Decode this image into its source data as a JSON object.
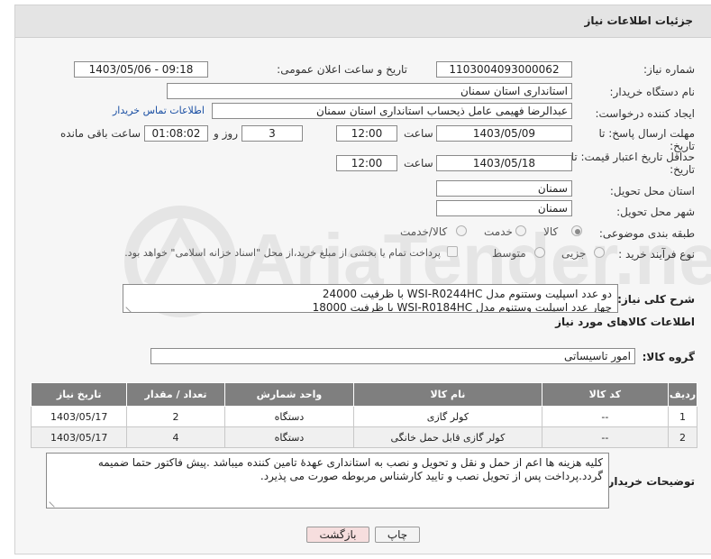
{
  "header": {
    "title": "جزئیات اطلاعات نیاز"
  },
  "fields": {
    "need_number": {
      "label": "شماره نیاز:",
      "value": "1103004093000062"
    },
    "announce_datetime": {
      "label": "تاریخ و ساعت اعلان عمومی:",
      "value": "1403/05/06 - 09:18"
    },
    "buyer_org": {
      "label": "نام دستگاه خریدار:",
      "value": "استانداری استان سمنان"
    },
    "requester": {
      "label": "ایجاد کننده درخواست:",
      "value": "عبدالرضا فهیمی عامل ذیحساب استانداری استان سمنان",
      "link": "اطلاعات تماس خریدار"
    },
    "reply_deadline": {
      "label_line1": "مهلت ارسال پاسخ: تا",
      "label_line2": "تاریخ:",
      "date": "1403/05/09",
      "time_label": "ساعت",
      "time": "12:00",
      "days": "3",
      "days_label": "روز و",
      "remaining": "01:08:02",
      "remaining_label": "ساعت باقی مانده"
    },
    "price_validity": {
      "label_line1": "حداقل تاریخ اعتبار قیمت: تا",
      "label_line2": "تاریخ:",
      "date": "1403/05/18",
      "time_label": "ساعت",
      "time": "12:00"
    },
    "delivery_province": {
      "label": "استان محل تحویل:",
      "value": "سمنان"
    },
    "delivery_city": {
      "label": "شهر محل تحویل:",
      "value": "سمنان"
    },
    "category": {
      "label": "طبقه بندی موضوعی:",
      "options": [
        "کالا",
        "خدمت",
        "کالا/خدمت"
      ],
      "selected": "کالا"
    },
    "purchase_type": {
      "label": "نوع فرآیند خرید :",
      "options": [
        "جزیی",
        "متوسط"
      ],
      "selected": "none",
      "checkbox_text": "پرداخت تمام یا بخشی از مبلغ خرید،از محل \"اسناد خزانه اسلامی\" خواهد بود."
    }
  },
  "description": {
    "label": "شرح کلی نیاز:",
    "line1": "دو عدد اسپلیت وستنوم مدل WSI-R0244HC با ظرفیت 24000",
    "line2": "چهار عدد اسپلیت وستنوم مدل WSI-R0184HC با ظرفیت 18000"
  },
  "goods_info": {
    "title": "اطلاعات کالاهای مورد نیاز",
    "group_label": "گروه کالا:",
    "group_value": "امور تاسیساتی"
  },
  "table": {
    "columns": [
      "ردیف",
      "کد کالا",
      "نام کالا",
      "واحد شمارش",
      "تعداد / مقدار",
      "تاریخ نیاز"
    ],
    "rows": [
      {
        "row": "1",
        "code": "--",
        "name": "کولر گازی",
        "unit": "دستگاه",
        "qty": "2",
        "date": "1403/05/17"
      },
      {
        "row": "2",
        "code": "--",
        "name": "کولر گازی قابل حمل خانگی",
        "unit": "دستگاه",
        "qty": "4",
        "date": "1403/05/17"
      }
    ]
  },
  "buyer_notes": {
    "label": "توضیحات خریدار:",
    "text": "کلیه هزینه ها اعم از حمل و نقل و تحویل و نصب به استانداری عهدهٔ تامین کننده میباشد .پیش فاکتور حتما ضمیمه گردد.پرداخت پس از تحویل نصب و تایید کارشناس مربوطه صورت می پذیرد."
  },
  "buttons": {
    "print": "چاپ",
    "back": "بازگشت"
  },
  "watermark": {
    "text": "AriaTender.neT"
  },
  "colors": {
    "table_header": "#7f7f7f",
    "link": "#1a4fa3",
    "back_button": "#f6dede",
    "panel": "#f6f6f6"
  }
}
